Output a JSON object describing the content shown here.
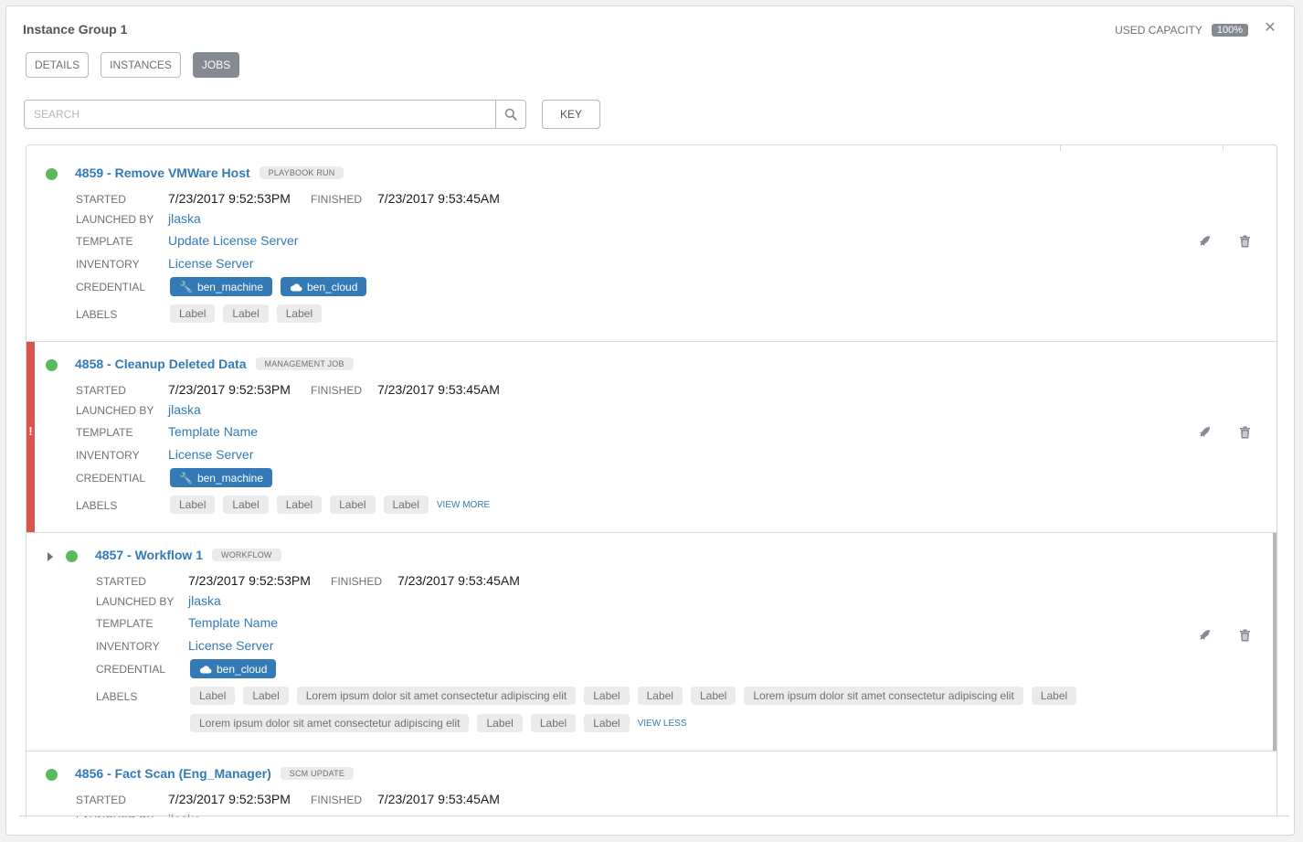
{
  "modal": {
    "title": "Instance Group 1",
    "capacity_label": "USED CAPACITY",
    "capacity_value": "100%"
  },
  "tabs": [
    {
      "label": "DETAILS",
      "active": false
    },
    {
      "label": "INSTANCES",
      "active": false
    },
    {
      "label": "JOBS",
      "active": true
    }
  ],
  "search": {
    "placeholder": "SEARCH"
  },
  "key_button": "KEY",
  "field_labels": {
    "started": "STARTED",
    "finished": "FINISHED",
    "launched_by": "LAUNCHED BY",
    "template": "TEMPLATE",
    "inventory": "INVENTORY",
    "credential": "CREDENTIAL",
    "labels": "LABELS"
  },
  "jobs": [
    {
      "name": "4859 - Remove VMWare Host",
      "type": "PLAYBOOK RUN",
      "status": "successful",
      "started": "7/23/2017 9:52:53PM",
      "finished": "7/23/2017 9:53:45AM",
      "launched_by": "jlaska",
      "template": "Update License Server",
      "inventory": "License Server",
      "credentials": [
        {
          "name": "ben_machine",
          "icon": "key-icon"
        },
        {
          "name": "ben_cloud",
          "icon": "cloud-icon"
        }
      ],
      "labels": [
        "Label",
        "Label",
        "Label"
      ]
    },
    {
      "name": "4858 - Cleanup Deleted Data",
      "type": "MANAGEMENT JOB",
      "status": "successful",
      "flagged": "!",
      "started": "7/23/2017 9:52:53PM",
      "finished": "7/23/2017 9:53:45AM",
      "launched_by": "jlaska",
      "template": "Template Name",
      "inventory": "License Server",
      "credentials": [
        {
          "name": "ben_machine",
          "icon": "key-icon"
        }
      ],
      "labels": [
        "Label",
        "Label",
        "Label",
        "Label",
        "Label"
      ],
      "view_toggle": "VIEW MORE"
    },
    {
      "name": "4857 - Workflow 1",
      "type": "WORKFLOW",
      "status": "successful",
      "started": "7/23/2017 9:52:53PM",
      "finished": "7/23/2017 9:53:45AM",
      "launched_by": "jlaska",
      "template": "Template Name",
      "inventory": "License Server",
      "credentials": [
        {
          "name": "ben_cloud",
          "icon": "cloud-icon"
        }
      ],
      "labels": [
        "Label",
        "Label",
        "Lorem ipsum dolor sit amet consectetur adipiscing elit",
        "Label",
        "Label",
        "Label",
        "Lorem ipsum dolor sit amet consectetur adipiscing elit",
        "Label",
        "Lorem ipsum dolor sit amet consectetur adipiscing elit",
        "Label",
        "Label",
        "Label"
      ],
      "view_toggle": "VIEW LESS"
    },
    {
      "name": "4856 - Fact Scan (Eng_Manager)",
      "type": "SCM UPDATE",
      "status": "successful",
      "started": "7/23/2017 9:52:53PM",
      "finished": "7/23/2017 9:53:45AM",
      "launched_by": "jlaska"
    }
  ]
}
